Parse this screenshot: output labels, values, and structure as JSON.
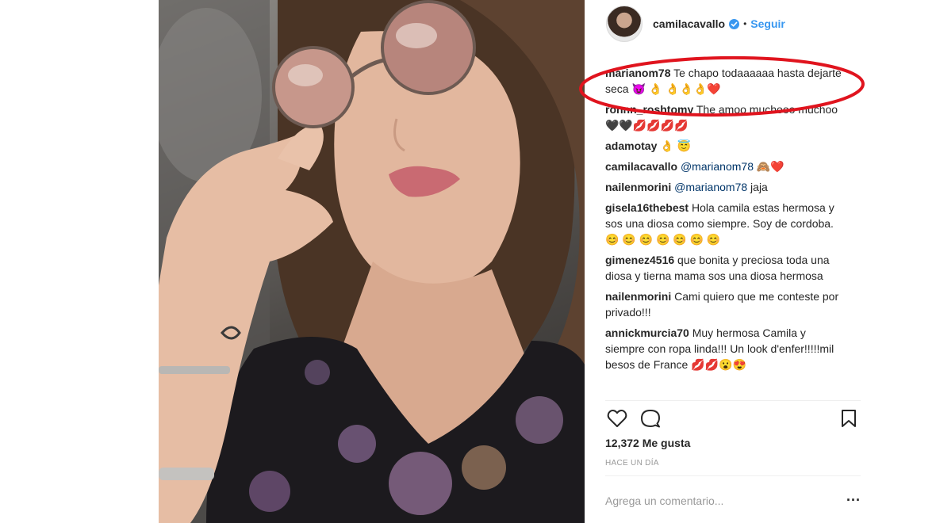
{
  "post": {
    "username": "camilacavallo",
    "separator": "•",
    "follow_label": "Seguir",
    "verified_icon": "verified-badge-icon",
    "accent_color": "#3897f0"
  },
  "comments": [
    {
      "user": "marianom78",
      "mention": "",
      "text": " Te chapo todaaaaaa hasta dejarte seca 😈 👌 👌👌👌❤️"
    },
    {
      "user": "ronnn_roshtomy",
      "mention": "",
      "text": " The amoo muchooo muchoo 🖤🖤💋💋💋💋"
    },
    {
      "user": "adamotay",
      "mention": "",
      "text": " 👌 😇"
    },
    {
      "user": "camilacavallo",
      "mention": "@marianom78",
      "text": " 🙈❤️"
    },
    {
      "user": "nailenmorini",
      "mention": "@marianom78",
      "text": " jaja"
    },
    {
      "user": "gisela16thebest",
      "mention": "",
      "text": " Hola camila estas hermosa y sos una diosa como siempre. Soy de cordoba. 😊 😊 😊 😊 😊 😊 😊"
    },
    {
      "user": "gimenez4516",
      "mention": "",
      "text": " que bonita y preciosa toda una diosa y tierna mama sos una diosa hermosa"
    },
    {
      "user": "nailenmorini",
      "mention": "",
      "text": " Cami quiero que me conteste por privado!!!"
    },
    {
      "user": "annickmurcia70",
      "mention": "",
      "text": " Muy hermosa Camila y siempre con ropa linda!!! Un look d'enfer!!!!!mil besos de France 💋💋😮😍"
    }
  ],
  "actions": {
    "like_icon": "heart-icon",
    "comment_icon": "comment-bubble-icon",
    "save_icon": "bookmark-icon"
  },
  "likes_text": "12,372 Me gusta",
  "timestamp": "HACE UN DÍA",
  "add_comment_placeholder": "Agrega un comentario...",
  "more_label": "...",
  "annotation_color": "#e0141e"
}
